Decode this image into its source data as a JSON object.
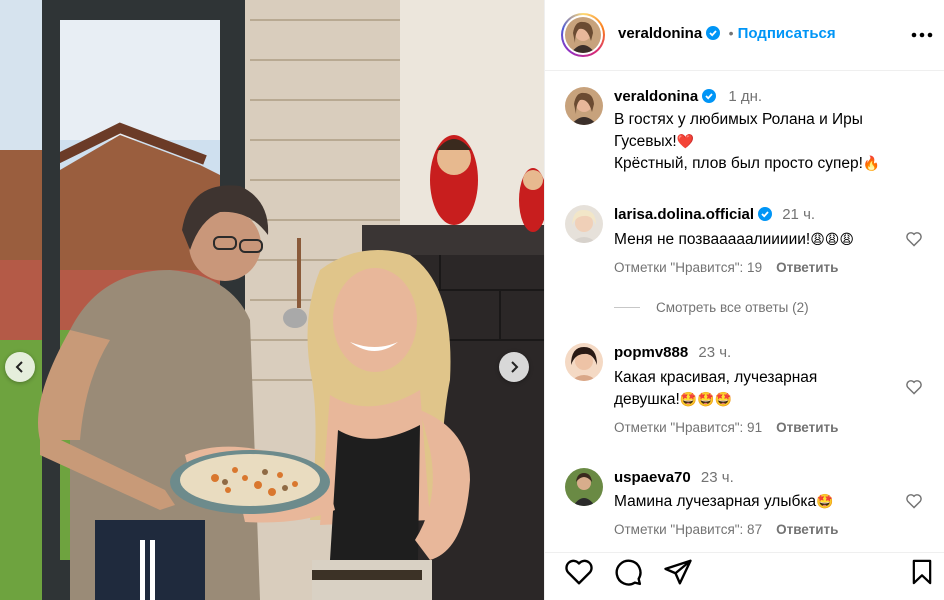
{
  "post": {
    "username": "veraldonina",
    "follow_label": "Подписаться",
    "separator": "•",
    "more_icon": "more-horizontal-icon"
  },
  "caption": {
    "username": "veraldonina",
    "time": "1 дн.",
    "line1": "В гостях у любимых Ролана и Иры",
    "line2": "Гусевых!",
    "line2_emoji": "❤️",
    "line3": "Крёстный, плов был просто супер!",
    "line3_emoji": "🔥"
  },
  "comments": [
    {
      "username": "larisa.dolina.official",
      "verified": true,
      "time": "21 ч.",
      "text": "Меня не позвааааалиииии!",
      "emojis": "😩😩😩",
      "likes": "Отметки \"Нравится\": 19",
      "reply": "Ответить"
    },
    {
      "username": "popmv888",
      "verified": false,
      "time": "23 ч.",
      "text": "Какая красивая, лучезарная",
      "text2": "девушка!",
      "emojis": "🤩🤩🤩",
      "likes": "Отметки \"Нравится\": 91",
      "reply": "Ответить"
    },
    {
      "username": "uspaeva70",
      "verified": false,
      "time": "23 ч.",
      "text": "Мамина лучезарная улыбка",
      "emojis": "🤩",
      "likes": "Отметки \"Нравится\": 87",
      "reply": "Ответить"
    }
  ],
  "view_replies": "Смотреть все ответы (2)",
  "colors": {
    "accent": "#0095f6",
    "verified": "#0095f6",
    "muted": "#737373",
    "heart": "#e0245e"
  },
  "icons": [
    "like-icon",
    "comment-icon",
    "share-icon",
    "save-icon",
    "chevron-left-icon",
    "chevron-right-icon",
    "verified-badge-icon",
    "heart-outline-icon"
  ]
}
